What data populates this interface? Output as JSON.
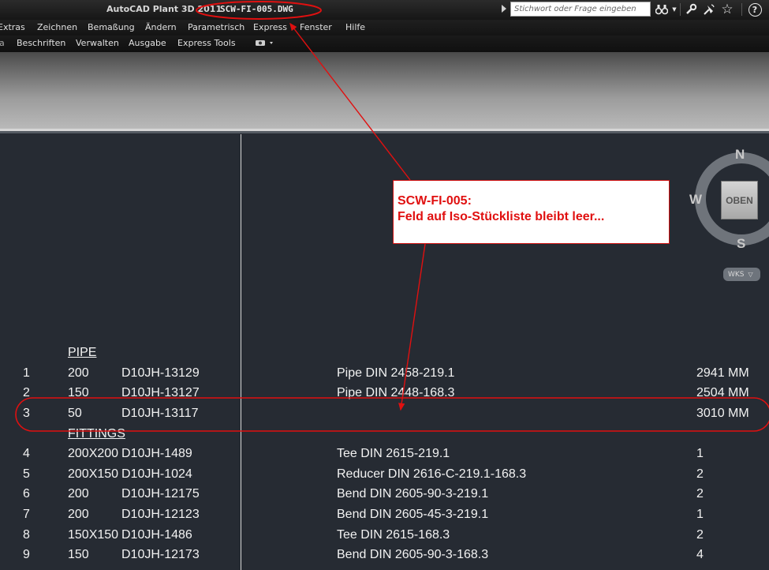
{
  "titlebar": {
    "app_name": "AutoCAD Plant 3D 2011",
    "file_name": "SCW-FI-005.DWG",
    "search_placeholder": "Stichwort oder Frage eingeben",
    "icons": [
      "play-icon",
      "binoculars-icon",
      "dropdown-arrow-icon",
      "wrench-icon",
      "satellite-icon",
      "star-icon",
      "help-icon"
    ],
    "help_label": "?"
  },
  "menu": {
    "items": [
      "Extras",
      "Zeichnen",
      "Bemaßung",
      "Ändern",
      "Parametrisch",
      "Express",
      "Fenster",
      "Hilfe"
    ]
  },
  "ribbon": {
    "tabs": [
      "Beschriften",
      "Verwalten",
      "Ausgabe",
      "Express Tools"
    ],
    "extra_icon": "camera-dropdown-icon"
  },
  "navigation": {
    "compass": {
      "north": "N",
      "south": "S",
      "west": "W"
    },
    "view_cube_label": "OBEN",
    "wks_label": "WKS",
    "wks_chevron": "▽"
  },
  "annotation": {
    "line1": "SCW-FI-005:",
    "line2": "Feld auf Iso-Stückliste bleibt leer...",
    "color": "#e01010"
  },
  "bom": {
    "sections": [
      {
        "heading": "PIPE",
        "rows": [
          {
            "no": "1",
            "size": "200",
            "code": "D10JH-13129",
            "description": "Pipe DIN 2458-219.1",
            "qty": "2941 MM"
          },
          {
            "no": "2",
            "size": "150",
            "code": "D10JH-13127",
            "description": "Pipe DIN 2448-168.3",
            "qty": "2504 MM"
          },
          {
            "no": "3",
            "size": "50",
            "code": "D10JH-13117",
            "description": "",
            "qty": "3010 MM"
          }
        ]
      },
      {
        "heading": "FITTINGS",
        "rows": [
          {
            "no": "4",
            "size": "200X200",
            "code": "D10JH-1489",
            "description": "Tee DIN 2615-219.1",
            "qty": "1"
          },
          {
            "no": "5",
            "size": "200X150",
            "code": "D10JH-1024",
            "description": "Reducer DIN 2616-C-219.1-168.3",
            "qty": "2"
          },
          {
            "no": "6",
            "size": "200",
            "code": "D10JH-12175",
            "description": "Bend DIN 2605-90-3-219.1",
            "qty": "2"
          },
          {
            "no": "7",
            "size": "200",
            "code": "D10JH-12123",
            "description": "Bend DIN 2605-45-3-219.1",
            "qty": "1"
          },
          {
            "no": "8",
            "size": "150X150",
            "code": "D10JH-1486",
            "description": "Tee DIN 2615-168.3",
            "qty": "2"
          },
          {
            "no": "9",
            "size": "150",
            "code": "D10JH-12173",
            "description": "Bend DIN 2605-90-3-168.3",
            "qty": "4"
          }
        ]
      }
    ]
  }
}
